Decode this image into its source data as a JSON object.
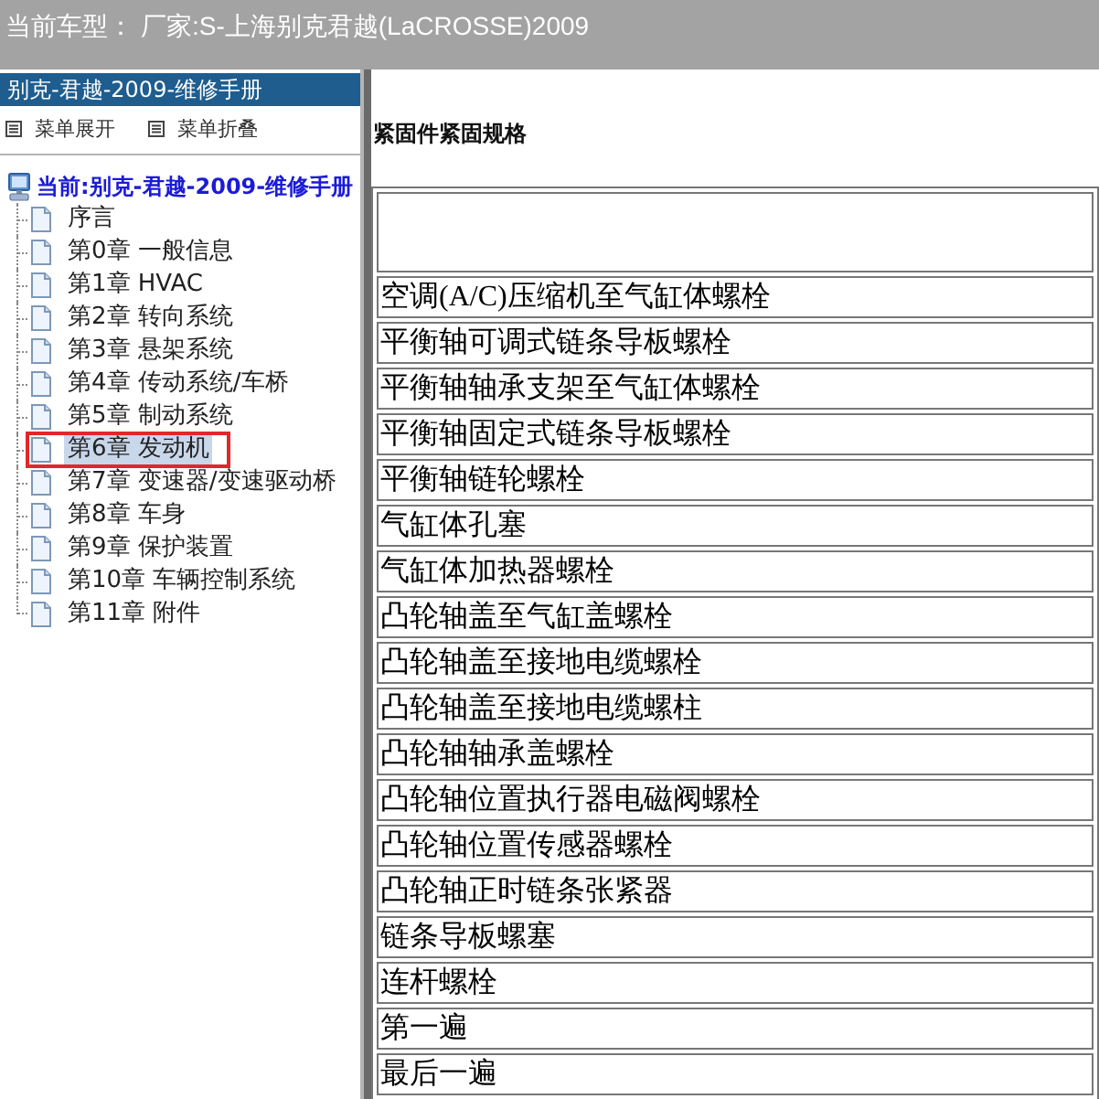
{
  "header": {
    "label": "当前车型：",
    "value": "厂家:S-上海别克君越(LaCROSSE)2009"
  },
  "sidebar": {
    "title": "别克-君越-2009-维修手册",
    "menu_actions": [
      {
        "label": "菜单展开"
      },
      {
        "label": "菜单折叠"
      }
    ],
    "tree": {
      "label": "当前:别克-君越-2009-维修手册",
      "children": [
        {
          "label": "序言",
          "selected": false,
          "highlighted": false
        },
        {
          "label": "第0章 一般信息",
          "selected": false,
          "highlighted": false
        },
        {
          "label": "第1章 HVAC",
          "selected": false,
          "highlighted": false
        },
        {
          "label": "第2章 转向系统",
          "selected": false,
          "highlighted": false
        },
        {
          "label": "第3章 悬架系统",
          "selected": false,
          "highlighted": false
        },
        {
          "label": "第4章 传动系统/车桥",
          "selected": false,
          "highlighted": false
        },
        {
          "label": "第5章 制动系统",
          "selected": false,
          "highlighted": false
        },
        {
          "label": "第6章 发动机",
          "selected": true,
          "highlighted": true
        },
        {
          "label": "第7章 变速器/变速驱动桥",
          "selected": false,
          "highlighted": false
        },
        {
          "label": "第8章 车身",
          "selected": false,
          "highlighted": false
        },
        {
          "label": "第9章 保护装置",
          "selected": false,
          "highlighted": false
        },
        {
          "label": "第10章 车辆控制系统",
          "selected": false,
          "highlighted": false
        },
        {
          "label": "第11章 附件",
          "selected": false,
          "highlighted": false
        }
      ]
    }
  },
  "content": {
    "title": "紧固件紧固规格",
    "table": {
      "rows": [
        "空调(A/C)压缩机至气缸体螺栓",
        "平衡轴可调式链条导板螺栓",
        "平衡轴轴承支架至气缸体螺栓",
        "平衡轴固定式链条导板螺栓",
        "平衡轴链轮螺栓",
        "气缸体孔塞",
        "气缸体加热器螺栓",
        "凸轮轴盖至气缸盖螺栓",
        "凸轮轴盖至接地电缆螺栓",
        "凸轮轴盖至接地电缆螺柱",
        "凸轮轴轴承盖螺栓",
        "凸轮轴位置执行器电磁阀螺栓",
        "凸轮轴位置传感器螺栓",
        "凸轮轴正时链条张紧器",
        "链条导板螺塞",
        "连杆螺栓",
        "第一遍",
        "最后一遍"
      ]
    }
  }
}
